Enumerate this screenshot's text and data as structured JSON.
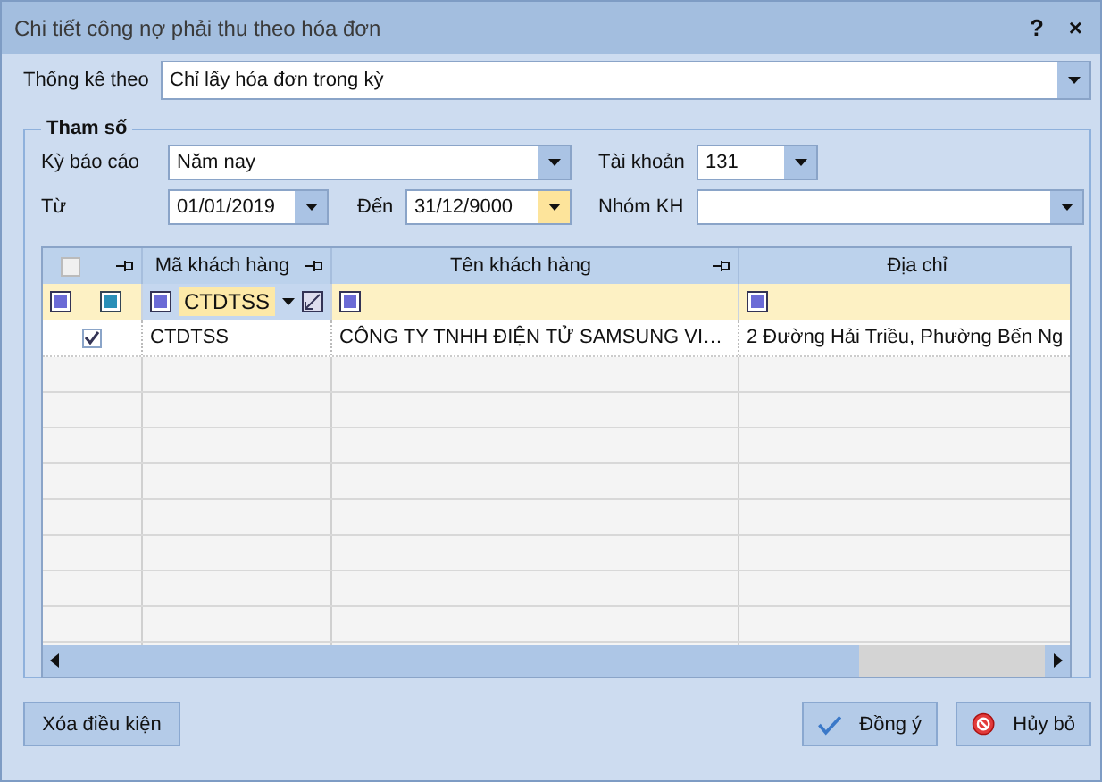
{
  "window": {
    "title": "Chi tiết công nợ phải thu theo hóa đơn",
    "help_button": "?",
    "close_button": "×"
  },
  "filter_by": {
    "label": "Thống kê theo",
    "value": "Chỉ lấy hóa đơn trong kỳ"
  },
  "parameters": {
    "title": "Tham số",
    "report_period": {
      "label": "Kỳ báo cáo",
      "value": "Năm nay"
    },
    "account": {
      "label": "Tài khoản",
      "value": "131"
    },
    "from": {
      "label": "Từ",
      "value": "01/01/2019",
      "highlighted": false
    },
    "to": {
      "label": "Đến",
      "value": "31/12/9000",
      "highlighted": true
    },
    "customer_group": {
      "label": "Nhóm KH"
    }
  },
  "table": {
    "select_all": {
      "checked": false
    },
    "columns": [
      {
        "label": "Mã khách hàng",
        "pinnable": true,
        "filter": "CTDTSS"
      },
      {
        "label": "Tên khách hàng",
        "pinnable": true
      },
      {
        "label": "Địa chỉ",
        "pinnable": false
      }
    ],
    "rows": [
      {
        "checked": true,
        "cells": [
          "CTDTSS",
          "CÔNG TY TNHH ĐIỆN TỬ SAMSUNG VI…",
          "2 Đường Hải Triều, Phường Bến Ng"
        ]
      }
    ]
  },
  "buttons": [
    {
      "kind": "clear",
      "label": "Xóa điều kiện"
    },
    {
      "kind": "ok",
      "label": "Đồng ý"
    },
    {
      "kind": "cancel",
      "label": "Hủy bỏ"
    }
  ]
}
